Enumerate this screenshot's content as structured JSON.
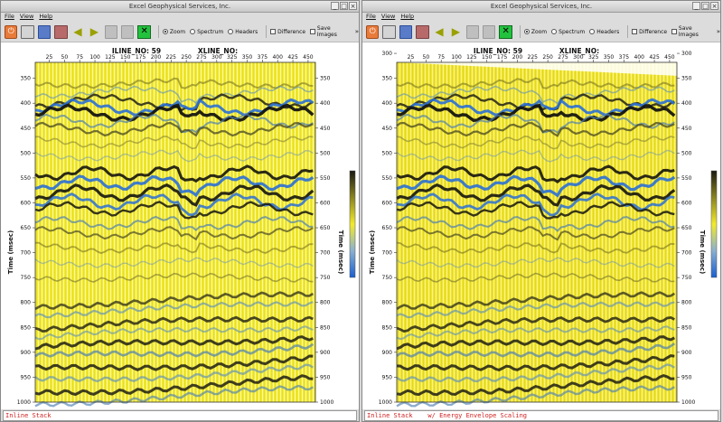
{
  "windows": [
    {
      "title": "Excel Geophysical Services, Inc.",
      "menu": [
        "File",
        "View",
        "Help"
      ],
      "radios": [
        "Zoom",
        "Spectrum",
        "Headers"
      ],
      "selected_radio": "Zoom",
      "checkboxes": [
        "Difference",
        "Save Images"
      ],
      "overflow": "»",
      "plot": {
        "iline_label": "ILINE_NO: 59",
        "xline_label": "XLINE_NO:",
        "y_label_left": "Time (msec)",
        "y_label_right": "Time (msec)",
        "x_ticks": [
          "25",
          "50",
          "75",
          "100",
          "125",
          "150",
          "175",
          "200",
          "225",
          "250",
          "275",
          "300",
          "325",
          "350",
          "375",
          "400",
          "425",
          "450"
        ],
        "y_ticks_left": [
          "350",
          "400",
          "450",
          "500",
          "550",
          "600",
          "650",
          "700",
          "750",
          "800",
          "850",
          "900",
          "950",
          "1000"
        ],
        "y_ticks_right": [
          "350",
          "400",
          "450",
          "500",
          "550",
          "600",
          "650",
          "700",
          "750",
          "800",
          "850",
          "900",
          "950",
          "1000"
        ]
      },
      "status": "Inline Stack"
    },
    {
      "title": "Excel Geophysical Services, Inc.",
      "menu": [
        "File",
        "View",
        "Help"
      ],
      "radios": [
        "Zoom",
        "Spectrum",
        "Headers"
      ],
      "selected_radio": "Zoom",
      "checkboxes": [
        "Difference",
        "Save Images"
      ],
      "overflow": "»",
      "plot": {
        "iline_label": "ILINE_NO: 59",
        "xline_label": "XLINE_NO:",
        "y_label_left": "Time (msec)",
        "y_label_right": "Time (msec)",
        "x_ticks": [
          "25",
          "50",
          "75",
          "100",
          "125",
          "150",
          "175",
          "200",
          "225",
          "250",
          "275",
          "300",
          "325",
          "350",
          "375",
          "400",
          "425",
          "450"
        ],
        "y_ticks_left": [
          "300",
          "350",
          "400",
          "450",
          "500",
          "550",
          "600",
          "650",
          "700",
          "750",
          "800",
          "850",
          "900",
          "950",
          "1000"
        ],
        "y_ticks_right": [
          "300",
          "350",
          "400",
          "450",
          "500",
          "550",
          "600",
          "650",
          "700",
          "750",
          "800",
          "850",
          "900",
          "950",
          "1000"
        ]
      },
      "status": "Inline Stack    w/ Energy Envelope Scaling"
    }
  ],
  "colors": {
    "background": "#f2ea2c",
    "trough": "#2a6fd6",
    "peak": "#1e1e10",
    "status_text": "#d02020"
  },
  "icons": [
    "power-icon",
    "print-icon",
    "save-icon",
    "save-as-icon",
    "back-arrow-icon",
    "forward-arrow-icon",
    "wrench-icon",
    "frame-icon",
    "exit-x-icon"
  ]
}
